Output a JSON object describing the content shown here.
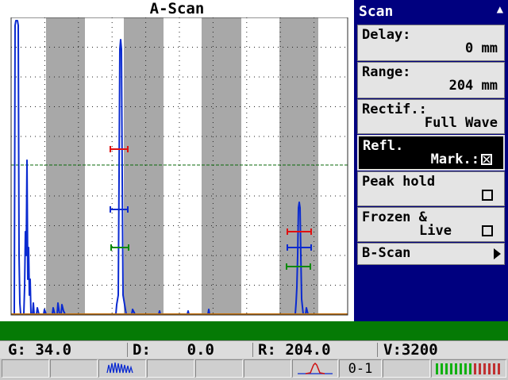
{
  "ascan": {
    "title": "A-Scan"
  },
  "menu": {
    "title": "Scan",
    "up_icon": "triangle-up-icon",
    "delay": {
      "label": "Delay:",
      "value": "0 mm"
    },
    "range": {
      "label": "Range:",
      "value": "204 mm"
    },
    "rectif": {
      "label": "Rectif.:",
      "value": "Full Wave"
    },
    "refl_mark": {
      "label_line1": "Refl.",
      "label_line2": "Mark.:",
      "checked": true
    },
    "peak_hold": {
      "label": "Peak hold",
      "checked": false
    },
    "frozen_live": {
      "label_line1": "Frozen &",
      "label_line2": "Live",
      "checked": false
    },
    "b_scan": {
      "label": "B-Scan",
      "icon": "submenu-arrow-icon"
    }
  },
  "status": {
    "gain": "G: 34.0",
    "delay": "D:    0.0",
    "range": "R: 204.0",
    "velocity": "V:3200"
  },
  "icons": {
    "rf_waveform": "rf-waveform-icon",
    "pulse": "pulse-peak-icon",
    "gate": "0-1",
    "battery": "battery-level-icon"
  },
  "colors": {
    "menu_bg": "#00007f",
    "status_green": "#057a05",
    "trace": "#0a2ad0",
    "gate_red": "#e01010",
    "gate_blue": "#0a2ad0",
    "gate_green": "#0a8a0a",
    "battery_green": "#10b010",
    "battery_red": "#c03030"
  },
  "battery": {
    "level_fraction": 0.55
  }
}
